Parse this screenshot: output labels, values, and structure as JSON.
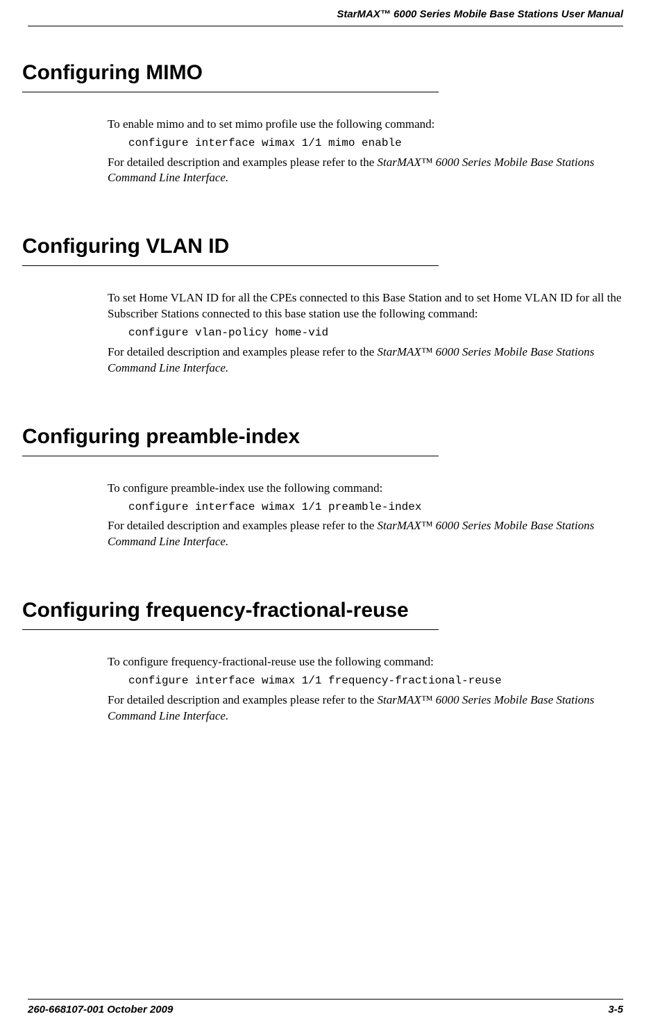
{
  "header": {
    "title": "StarMAX™ 6000 Series Mobile Base Stations User Manual"
  },
  "sections": [
    {
      "heading": "Configuring MIMO",
      "intro": "To enable mimo and to set mimo profile use the following command:",
      "code": "configure interface wimax 1/1 mimo enable",
      "desc_prefix": "For detailed description and examples please refer to the ",
      "desc_ref": "StarMAX™ 6000 Series Mobile Base Stations Command Line Interface.",
      "desc_suffix": ""
    },
    {
      "heading": "Configuring VLAN ID",
      "intro": "To set Home VLAN ID for all the CPEs connected to this Base Station and to set Home VLAN ID for all the Subscriber Stations connected to this base station use the following command:",
      "code": "configure vlan-policy home-vid",
      "desc_prefix": "For detailed description and examples please refer to the ",
      "desc_ref": "StarMAX™ 6000 Series Mobile Base Stations Command Line Interface.",
      "desc_suffix": ""
    },
    {
      "heading": "Configuring preamble-index",
      "intro": "To configure preamble-index use the following command:",
      "code": "configure interface wimax 1/1 preamble-index",
      "desc_prefix": "For detailed description and examples please refer to the ",
      "desc_ref": "StarMAX™ 6000 Series Mobile Base Stations Command Line Interface.",
      "desc_suffix": ""
    },
    {
      "heading": "Configuring frequency-fractional-reuse",
      "intro": "To configure frequency-fractional-reuse use the following command:",
      "code": "configure interface wimax 1/1 frequency-fractional-reuse",
      "desc_prefix": "For detailed description and examples please refer to the ",
      "desc_ref": "StarMAX™ 6000 Series Mobile Base Stations Command Line Interface.",
      "desc_suffix": ""
    }
  ],
  "footer": {
    "left": "260-668107-001 October 2009",
    "right": "3-5"
  }
}
